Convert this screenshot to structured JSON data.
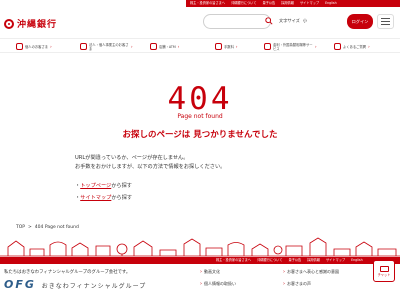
{
  "topbar": {
    "links": [
      "株主・投資家の皆さまへ",
      "沖縄銀行について",
      "量子公告",
      "採用情報",
      "サイトマップ",
      "English"
    ]
  },
  "header": {
    "logo_text": "沖縄銀行",
    "search_placeholder": "",
    "font_size_label": "文字サイズ",
    "font_size_small": "小",
    "login_label": "ログイン",
    "menu_icon": "hamburger-icon"
  },
  "nav": {
    "items": [
      {
        "label": "個人のお客さま",
        "icon": "person-icon"
      },
      {
        "label": "法人・個人事業主のお客さま",
        "icon": "building-icon"
      },
      {
        "label": "店舗・ATM",
        "icon": "map-pin-icon"
      },
      {
        "label": "手数料",
        "icon": "yen-icon"
      },
      {
        "label": "金利・外国為替相場等サービス",
        "icon": "chart-icon"
      },
      {
        "label": "よくあるご質問",
        "icon": "question-icon"
      }
    ]
  },
  "error": {
    "code": "404",
    "subtitle": "Page not found",
    "headline": "お探しのページは 見つかりませんでした",
    "lines": [
      "URLが間違っているか、ページが存在しません。",
      "お手数をおかけしますが、以下の方法で情報をお探しください。"
    ],
    "link1_text": "トップページ",
    "link1_suffix": "から探す",
    "link2_text": "サイトマップ",
    "link2_suffix": "から探す"
  },
  "breadcrumb": {
    "top": "TOP",
    "sep": ">",
    "current": "404 Page not found"
  },
  "footer": {
    "bar_links": [
      "株主・投資家の皆さまへ",
      "沖縄銀行について",
      "量子公告",
      "採用情報",
      "サイトマップ",
      "English"
    ],
    "group_text": "私たちはおきなわフィナンシャルグループのグループ会社です。",
    "group_logo": "OFG",
    "group_logo_sub": "おきなわフィナンシャルグループ",
    "col1": [
      "動画文化",
      "個人情報の取扱い"
    ],
    "col2": [
      "お客さまへ表心と感謝の意図",
      "お客さまの声"
    ],
    "chat_label": "チャット"
  },
  "colors": {
    "brand_red": "#c7000b"
  }
}
